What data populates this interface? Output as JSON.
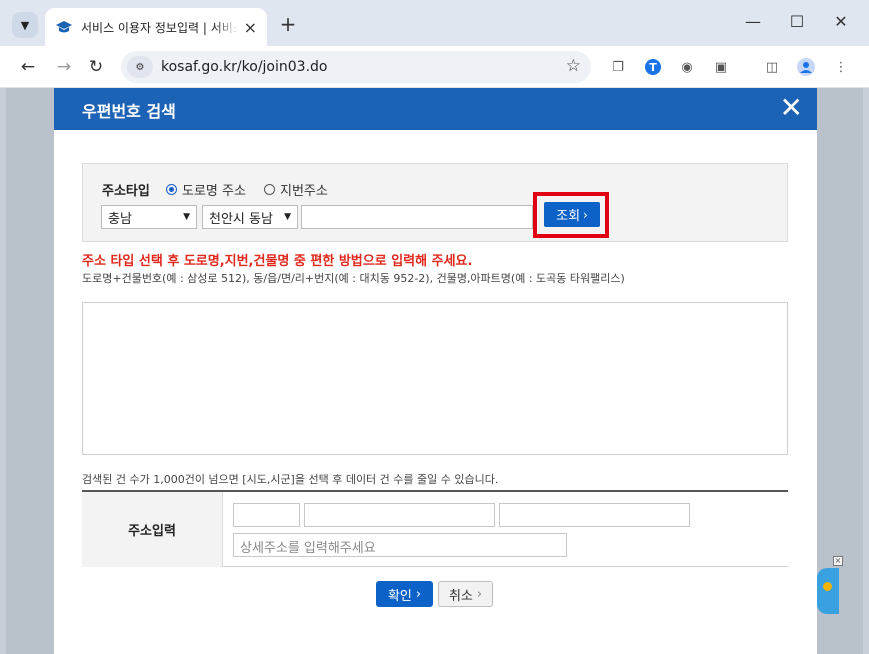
{
  "browser": {
    "tab_title": "서비스 이용자 정보입력 | 서비스 이용",
    "url": "kosaf.go.kr/ko/join03.do"
  },
  "modal": {
    "title": "우편번호 검색",
    "address_type_label": "주소타입",
    "radio_road": "도로명 주소",
    "radio_jibun": "지번주소",
    "selected_radio": "도로명 주소",
    "province_value": "충남",
    "city_value": "천안시 동남",
    "search_button": "조회",
    "warning": "주소 타입 선택 후 도로명,지번,건물명 중 편한 방법으로 입력해 주세요.",
    "hint": "도로명+건물번호(예 : 삼성로 512), 동/읍/면/리+번지(예 : 대치동 952-2), 건물명,아파트명(예 : 도곡동 타워팰리스)",
    "notice": "검색된 건 수가 1,000건이 넘으면 [시도,시군]을 선택 후 데이터 건 수를 줄일 수 있습니다.",
    "address_input_label": "주소입력",
    "detail_placeholder": "상세주소를 입력해주세요",
    "confirm_button": "확인",
    "cancel_button": "취소"
  },
  "colors": {
    "header_blue": "#1d63b5",
    "button_blue": "#0d62c8",
    "warning_red": "#e0281d",
    "highlight_red": "#e00012"
  }
}
